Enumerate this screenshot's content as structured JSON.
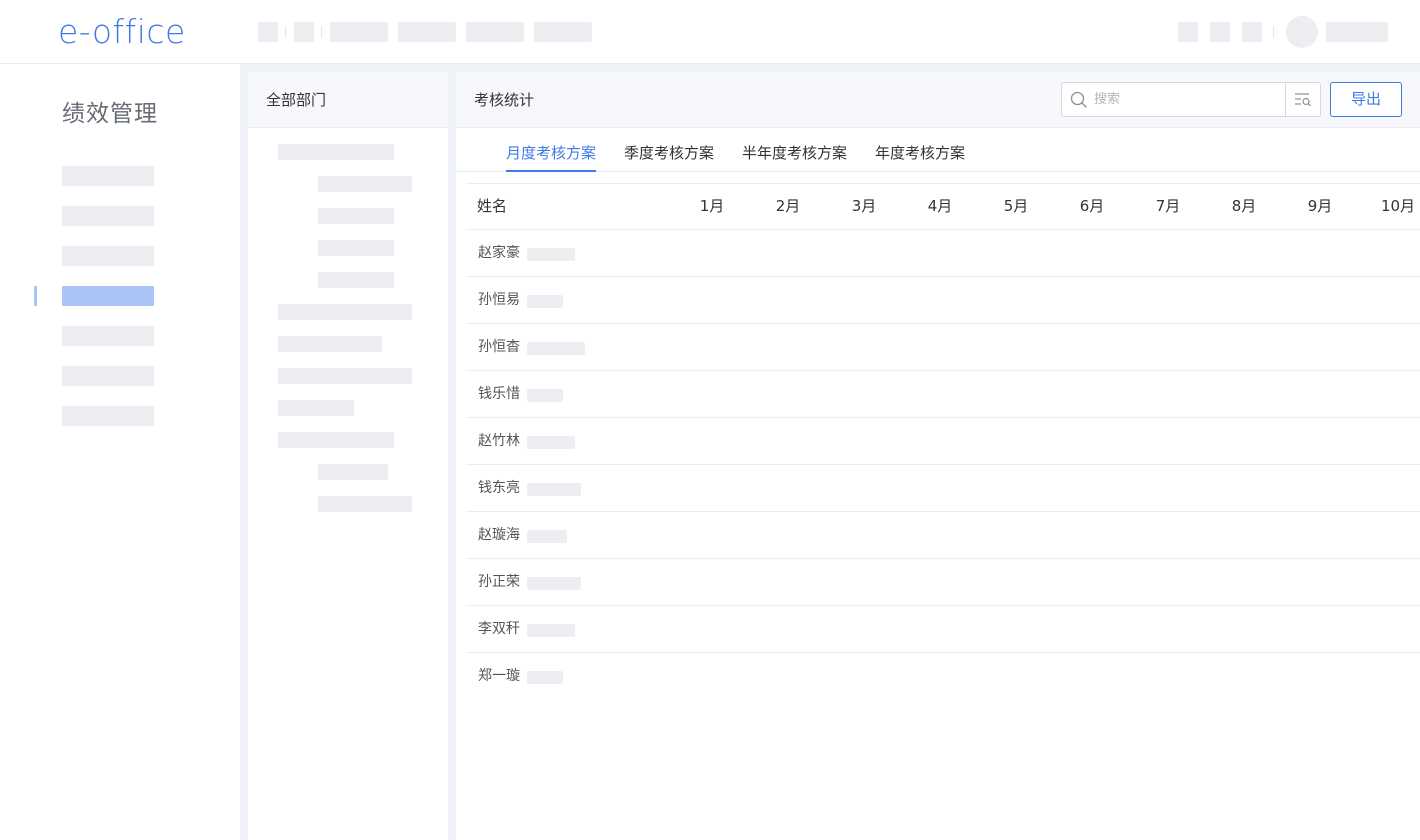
{
  "app": {
    "logo_text": "e-office",
    "module_title": "绩效管理"
  },
  "department_panel": {
    "title": "全部部门"
  },
  "main": {
    "title": "考核统计",
    "search": {
      "placeholder": "搜索",
      "value": ""
    },
    "export_label": "导出",
    "tabs": [
      {
        "label": "月度考核方案",
        "active": true
      },
      {
        "label": "季度考核方案",
        "active": false
      },
      {
        "label": "半年度考核方案",
        "active": false
      },
      {
        "label": "年度考核方案",
        "active": false
      }
    ],
    "table": {
      "name_header": "姓名",
      "month_headers": [
        "1月",
        "2月",
        "3月",
        "4月",
        "5月",
        "6月",
        "7月",
        "8月",
        "9月",
        "10月"
      ],
      "rows": [
        {
          "name": "赵家豪"
        },
        {
          "name": "孙恒易"
        },
        {
          "name": "孙恒杳"
        },
        {
          "name": "钱乐惜"
        },
        {
          "name": "赵竹林"
        },
        {
          "name": "钱东亮"
        },
        {
          "name": "赵璇海"
        },
        {
          "name": "孙正荣"
        },
        {
          "name": "李双秆"
        },
        {
          "name": "郑一璇"
        }
      ]
    }
  },
  "colors": {
    "accent": "#3f7be6",
    "skeleton": "#edeef2",
    "active_nav": "#a8c4f5"
  }
}
